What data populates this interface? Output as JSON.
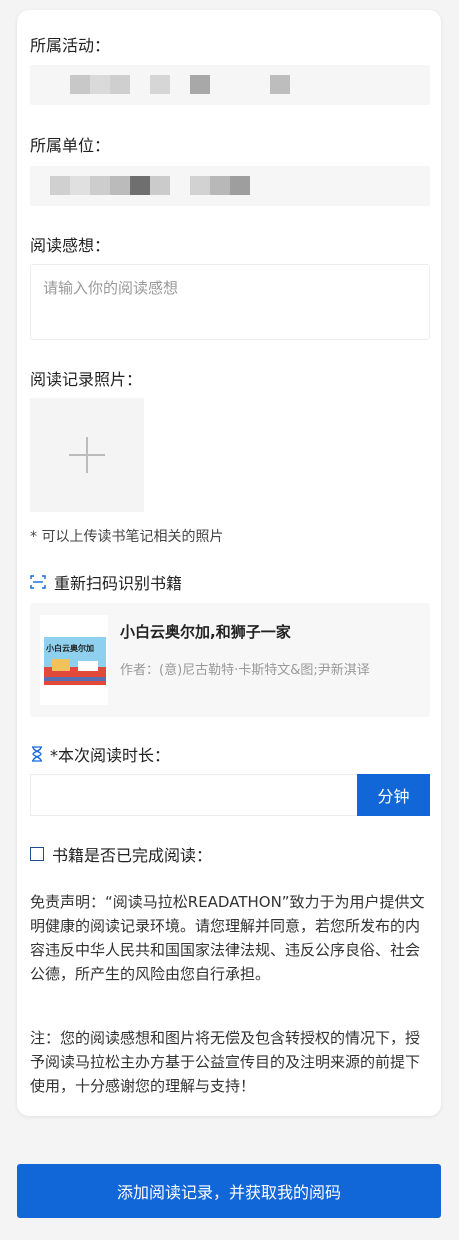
{
  "form": {
    "activity_label": "所属活动：",
    "unit_label": "所属单位：",
    "thoughts_label": "阅读感想：",
    "thoughts_placeholder": "请输入你的阅读感想",
    "photos_label": "阅读记录照片：",
    "photos_hint": "* 可以上传读书笔记相关的照片",
    "rescan_label": "重新扫码识别书籍",
    "duration_label": "*本次阅读时长：",
    "duration_value": "",
    "duration_unit": "分钟",
    "finished_label": "书籍是否已完成阅读：",
    "finished_checked": false
  },
  "book": {
    "title": "小白云奥尔加,和狮子一家",
    "author": "作者：(意)尼古勒特·卡斯特文&图;尹新淇译",
    "cover_text": "小白云奥尔加"
  },
  "disclaimer": "免责声明：“阅读马拉松READATHON”致力于为用户提供文明健康的阅读记录环境。请您理解并同意，若您所发布的内容违反中华人民共和国国家法律法规、违反公序良俗、社会公德，所产生的风险由您自行承担。",
  "note": "注：您的阅读感想和图片将无偿及包含转授权的情况下，授予阅读马拉松主办方基于公益宣传目的及注明来源的前提下使用，十分感谢您的理解与支持！",
  "submit_label": "添加阅读记录，并获取我的阅码",
  "colors": {
    "accent": "#1167d7",
    "background": "#f4f4f4"
  },
  "icons": {
    "rescan": "scan-icon",
    "duration": "hourglass-icon",
    "upload": "plus-icon"
  }
}
